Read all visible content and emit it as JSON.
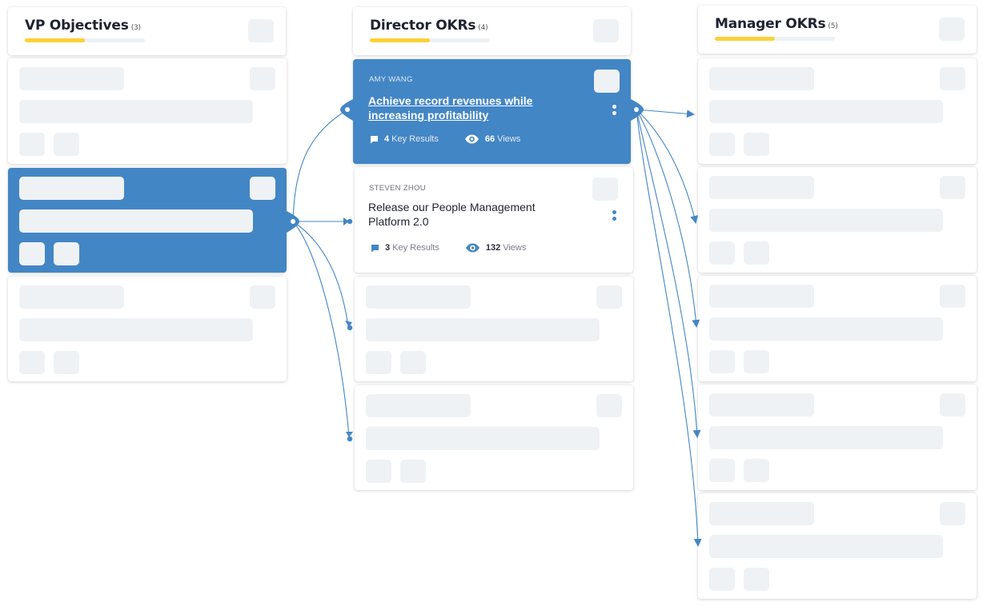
{
  "colors": {
    "accent": "#4386c5",
    "progress": "#fbd137",
    "skeleton": "#eff2f5",
    "text": "#1f2230"
  },
  "columns": [
    {
      "title": "VP Objectives",
      "count": "(3)",
      "progress": 0.5
    },
    {
      "title": "Director OKRs",
      "count": "(4)",
      "progress": 0.5
    },
    {
      "title": "Manager OKRs",
      "count": "(5)",
      "progress": 0.5
    }
  ],
  "director_cards": [
    {
      "owner": "AMY WANG",
      "title": "Achieve record revenues while increasing profitability",
      "key_results_count": "4",
      "key_results_label": "Key Results",
      "views_count": "66",
      "views_label": "Views",
      "selected": true
    },
    {
      "owner": "STEVEN ZHOU",
      "title": "Release our People Management Platform 2.0",
      "key_results_count": "3",
      "key_results_label": "Key Results",
      "views_count": "132",
      "views_label": "Views",
      "selected": false
    }
  ],
  "icons": {
    "key_results": "comment-icon",
    "views": "eye-icon",
    "menu": "kebab-menu-icon"
  }
}
